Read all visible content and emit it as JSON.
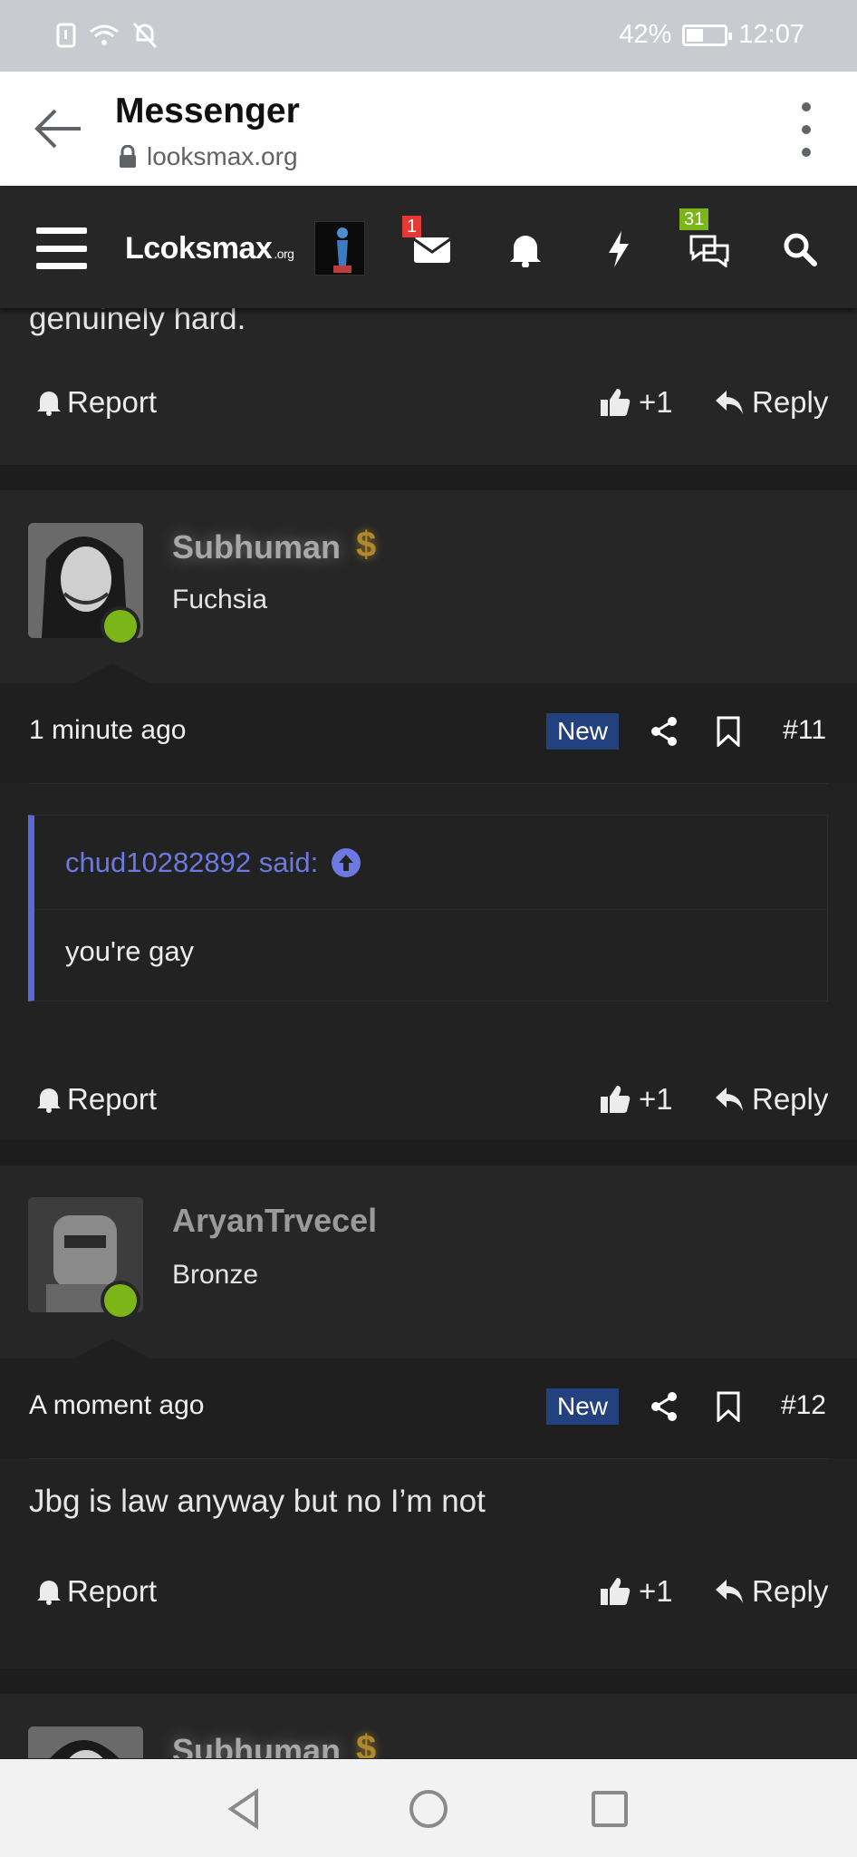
{
  "status_bar": {
    "battery_percent": "42%",
    "time": "12:07",
    "battery_level": 0.42
  },
  "browser": {
    "title": "Messenger",
    "url": "looksmax.org"
  },
  "site_nav": {
    "logo_text": "Lcoksmax",
    "logo_suffix": ".org",
    "inbox_badge": "1",
    "alerts_badge": "31"
  },
  "previous_post": {
    "tail_text": "genuinely hard."
  },
  "actions": {
    "report": "Report",
    "like": "+1",
    "reply": "Reply"
  },
  "posts": [
    {
      "username": "Subhuman",
      "rank": "Fuchsia",
      "time": "1 minute ago",
      "new_label": "New",
      "number": "#11",
      "quote": {
        "author": "chud10282892 said:",
        "text": "you're gay"
      }
    },
    {
      "username": "AryanTrvecel",
      "rank": "Bronze",
      "time": "A moment ago",
      "new_label": "New",
      "number": "#12",
      "body": "Jbg is law anyway but no I’m not"
    },
    {
      "username": "Subhuman"
    }
  ],
  "colors": {
    "online": "#7cb518",
    "new_badge": "#23417d",
    "quote_accent": "#5c68d6",
    "inbox_badge": "#e53935",
    "alerts_badge": "#7cb518"
  }
}
